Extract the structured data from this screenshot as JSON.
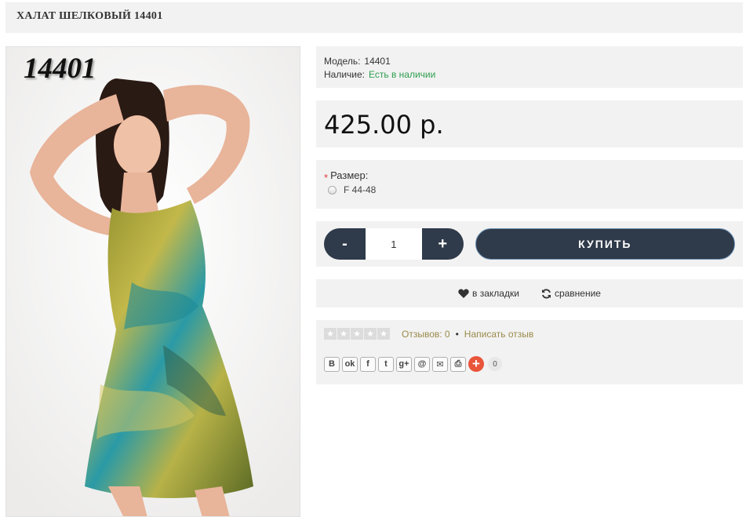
{
  "product": {
    "title": "ХАЛАТ ШЕЛКОВЫЙ 14401",
    "image_label": "14401"
  },
  "info": {
    "model_label": "Модель:",
    "model_value": "14401",
    "stock_label": "Наличие:",
    "stock_value": "Есть в наличии"
  },
  "price": "425.00 р.",
  "options": {
    "required_mark": "*",
    "size_label": "Размер:",
    "size_options": [
      "F 44-48"
    ]
  },
  "purchase": {
    "minus_label": "-",
    "quantity": "1",
    "plus_label": "+",
    "buy_label": "КУПИТЬ"
  },
  "actions": {
    "wishlist_label": "в закладки",
    "compare_label": "сравнение"
  },
  "reviews": {
    "rating": 0,
    "max_rating": 5,
    "reviews_label": "Отзывов: 0",
    "separator": "•",
    "write_review_label": "Написать отзыв"
  },
  "share": {
    "buttons": [
      {
        "icon": "vk-icon",
        "glyph": "В"
      },
      {
        "icon": "odnoklassniki-icon",
        "glyph": "ok"
      },
      {
        "icon": "facebook-icon",
        "glyph": "f"
      },
      {
        "icon": "twitter-icon",
        "glyph": "t"
      },
      {
        "icon": "google-plus-icon",
        "glyph": "g+"
      },
      {
        "icon": "mail-ru-icon",
        "glyph": "@"
      },
      {
        "icon": "email-icon",
        "glyph": "✉"
      },
      {
        "icon": "print-icon",
        "glyph": "⎙"
      }
    ],
    "count": "0"
  },
  "colors": {
    "panel_bg": "#f2f2f2",
    "button_dark": "#2f3a4a",
    "stock_green": "#2e9e4e",
    "review_link": "#9a8a4a",
    "share_plus": "#e8553a"
  }
}
